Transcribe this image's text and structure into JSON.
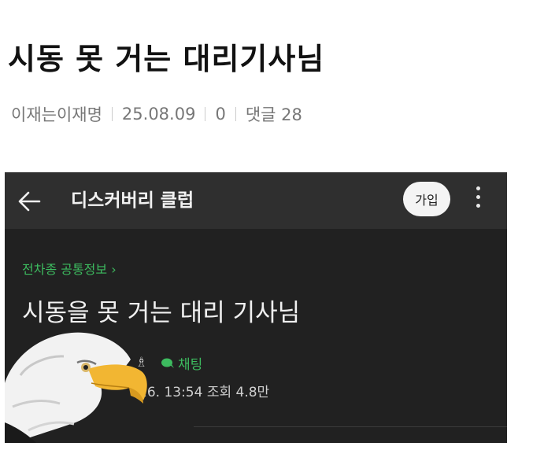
{
  "post": {
    "title": "시동 못 거는 대리기사님",
    "author": "이재는이재명",
    "date": "25.08.09",
    "likes": "0",
    "comments_label": "댓글 28"
  },
  "screenshot": {
    "club_name": "디스커버리 클럽",
    "join_label": "가입",
    "category": "전차종 공통정보 ›",
    "article_title": "시동을 못 거는 대리 기사님",
    "chat_label": "채팅",
    "date_views": "26. 13:54  조회 4.8만"
  },
  "icons": {
    "back": "arrow-left-icon",
    "more": "kebab-menu-icon",
    "chat": "chat-bubble-icon",
    "medal": "medal-icon"
  },
  "colors": {
    "accent_green": "#3dbb5f",
    "dark_bg": "#212121",
    "topbar_bg": "#2f2f2f"
  }
}
